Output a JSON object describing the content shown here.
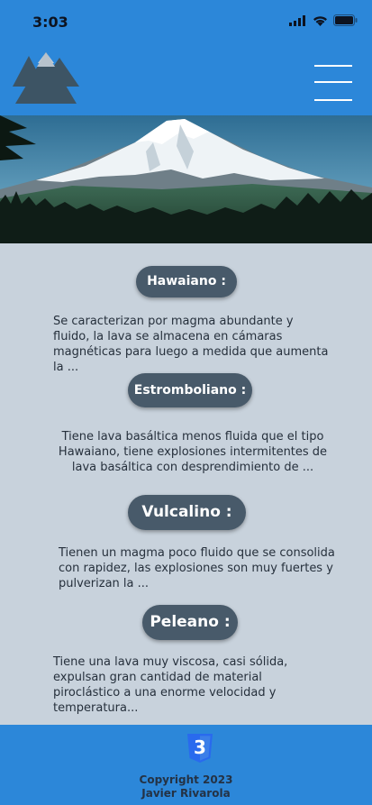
{
  "status_bar": {
    "time": "3:03",
    "icons": [
      "cellular-signal-icon",
      "wifi-icon",
      "battery-icon"
    ]
  },
  "header": {
    "logo": "mountain-logo-icon",
    "menu": "hamburger-menu-icon",
    "color": "#2c87d9"
  },
  "hero": {
    "subject": "snow-capped-mountain-photo"
  },
  "sections": [
    {
      "title": "Hawaiano :",
      "text": "Se caracterizan por magma abundante y fluido, la lava se almacena en cámaras magnéticas para luego a medida que aumenta la ..."
    },
    {
      "title": "Estromboliano :",
      "text": "Tiene lava basáltica menos fluida que el tipo Hawaiano, tiene explosiones intermitentes de lava basáltica con desprendimiento de ..."
    },
    {
      "title": "Vulcalino :",
      "text": "Tienen un magma poco fluido que se consolida con rapidez, las explosiones son muy fuertes y pulverizan la ..."
    },
    {
      "title": "Peleano :",
      "text": "Tiene una lava muy viscosa, casi sólida, expulsan gran cantidad de material piroclástico a una enorme velocidad y temperatura..."
    }
  ],
  "footer": {
    "badge_icon": "css3-icon",
    "badge_text": "3",
    "copyright_line1": "Copyright 2023",
    "copyright_line2": "Javier Rivarola"
  },
  "colors": {
    "accent": "#2c87d9",
    "pill": "#485a6a",
    "background": "#c8d2dc"
  }
}
